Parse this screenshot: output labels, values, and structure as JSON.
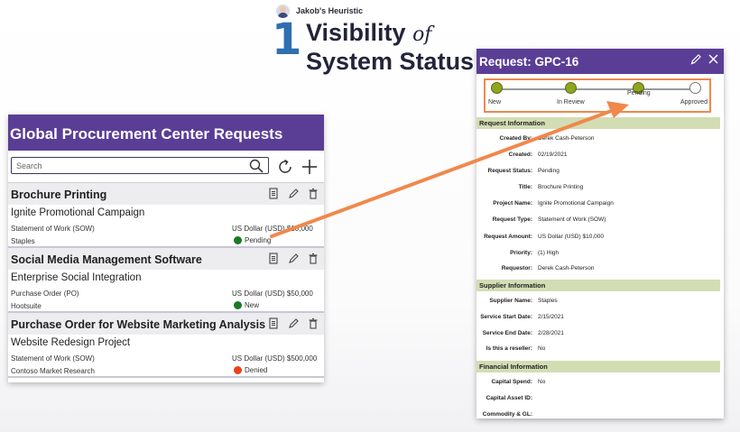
{
  "heading": {
    "kicker": "Jakob's Heuristic",
    "number": "1",
    "title_main": "Visibility",
    "title_of": "of",
    "title_line2": "System Status"
  },
  "list": {
    "title": "Global Procurement Center Requests",
    "search": {
      "placeholder": "Search",
      "value": ""
    },
    "items": [
      {
        "title": "Brochure Printing",
        "project": "Ignite Promotional Campaign",
        "type": "Statement of Work (SOW)",
        "amount": "US Dollar (USD) $10,000",
        "supplier": "Staples",
        "status": "Pending",
        "status_color": "#1a7a24"
      },
      {
        "title": "Social Media Management Software",
        "project": "Enterprise Social Integration",
        "type": "Purchase Order (PO)",
        "amount": "US Dollar (USD) $50,000",
        "supplier": "Hootsuite",
        "status": "New",
        "status_color": "#1a7a24"
      },
      {
        "title": "Purchase Order for Website Marketing Analysis",
        "project": "Website Redesign Project",
        "type": "Statement of Work (SOW)",
        "amount": "US Dollar (USD) $500,000",
        "supplier": "Contoso Market Research",
        "status": "Denied",
        "status_color": "#e8421b"
      }
    ]
  },
  "detail": {
    "title": "Request: GPC-16",
    "steps": [
      "New",
      "In Review",
      "Pending",
      "Approved"
    ],
    "current_step": "Pending",
    "sections": {
      "request": {
        "title": "Request Information",
        "fields": [
          {
            "label": "Created By:",
            "value": "Derek Cash-Peterson"
          },
          {
            "label": "Created:",
            "value": "02/19/2021"
          },
          {
            "label": "Request Status:",
            "value": "Pending"
          },
          {
            "label": "Title:",
            "value": "Brochure Printing"
          },
          {
            "label": "Project Name:",
            "value": "Ignite Promotional Campaign"
          },
          {
            "label": "Request Type:",
            "value": "Statement of Work (SOW)"
          },
          {
            "label": "Request Amount:",
            "value": "US Dollar (USD) $10,000"
          },
          {
            "label": "Priority:",
            "value": "(1) High"
          },
          {
            "label": "Requestor:",
            "value": "Derek Cash-Peterson"
          }
        ]
      },
      "supplier": {
        "title": "Supplier Information",
        "fields": [
          {
            "label": "Supplier Name:",
            "value": "Staples"
          },
          {
            "label": "Service Start Date:",
            "value": "2/15/2021"
          },
          {
            "label": "Service End Date:",
            "value": "2/28/2021"
          },
          {
            "label": "Is this a reseller:",
            "value": "No"
          }
        ]
      },
      "financial": {
        "title": "Financial Information",
        "fields": [
          {
            "label": "Capital Spend:",
            "value": "No"
          },
          {
            "label": "Capital Asset ID:",
            "value": ""
          },
          {
            "label": "Commodity & GL:",
            "value": ""
          }
        ]
      }
    }
  },
  "colors": {
    "brand_purple": "#5a3e96",
    "highlight_orange": "#f0884c",
    "step_complete": "#8fa51f",
    "section_header": "#d3ddb4",
    "heading_number": "#2f6fb1"
  }
}
